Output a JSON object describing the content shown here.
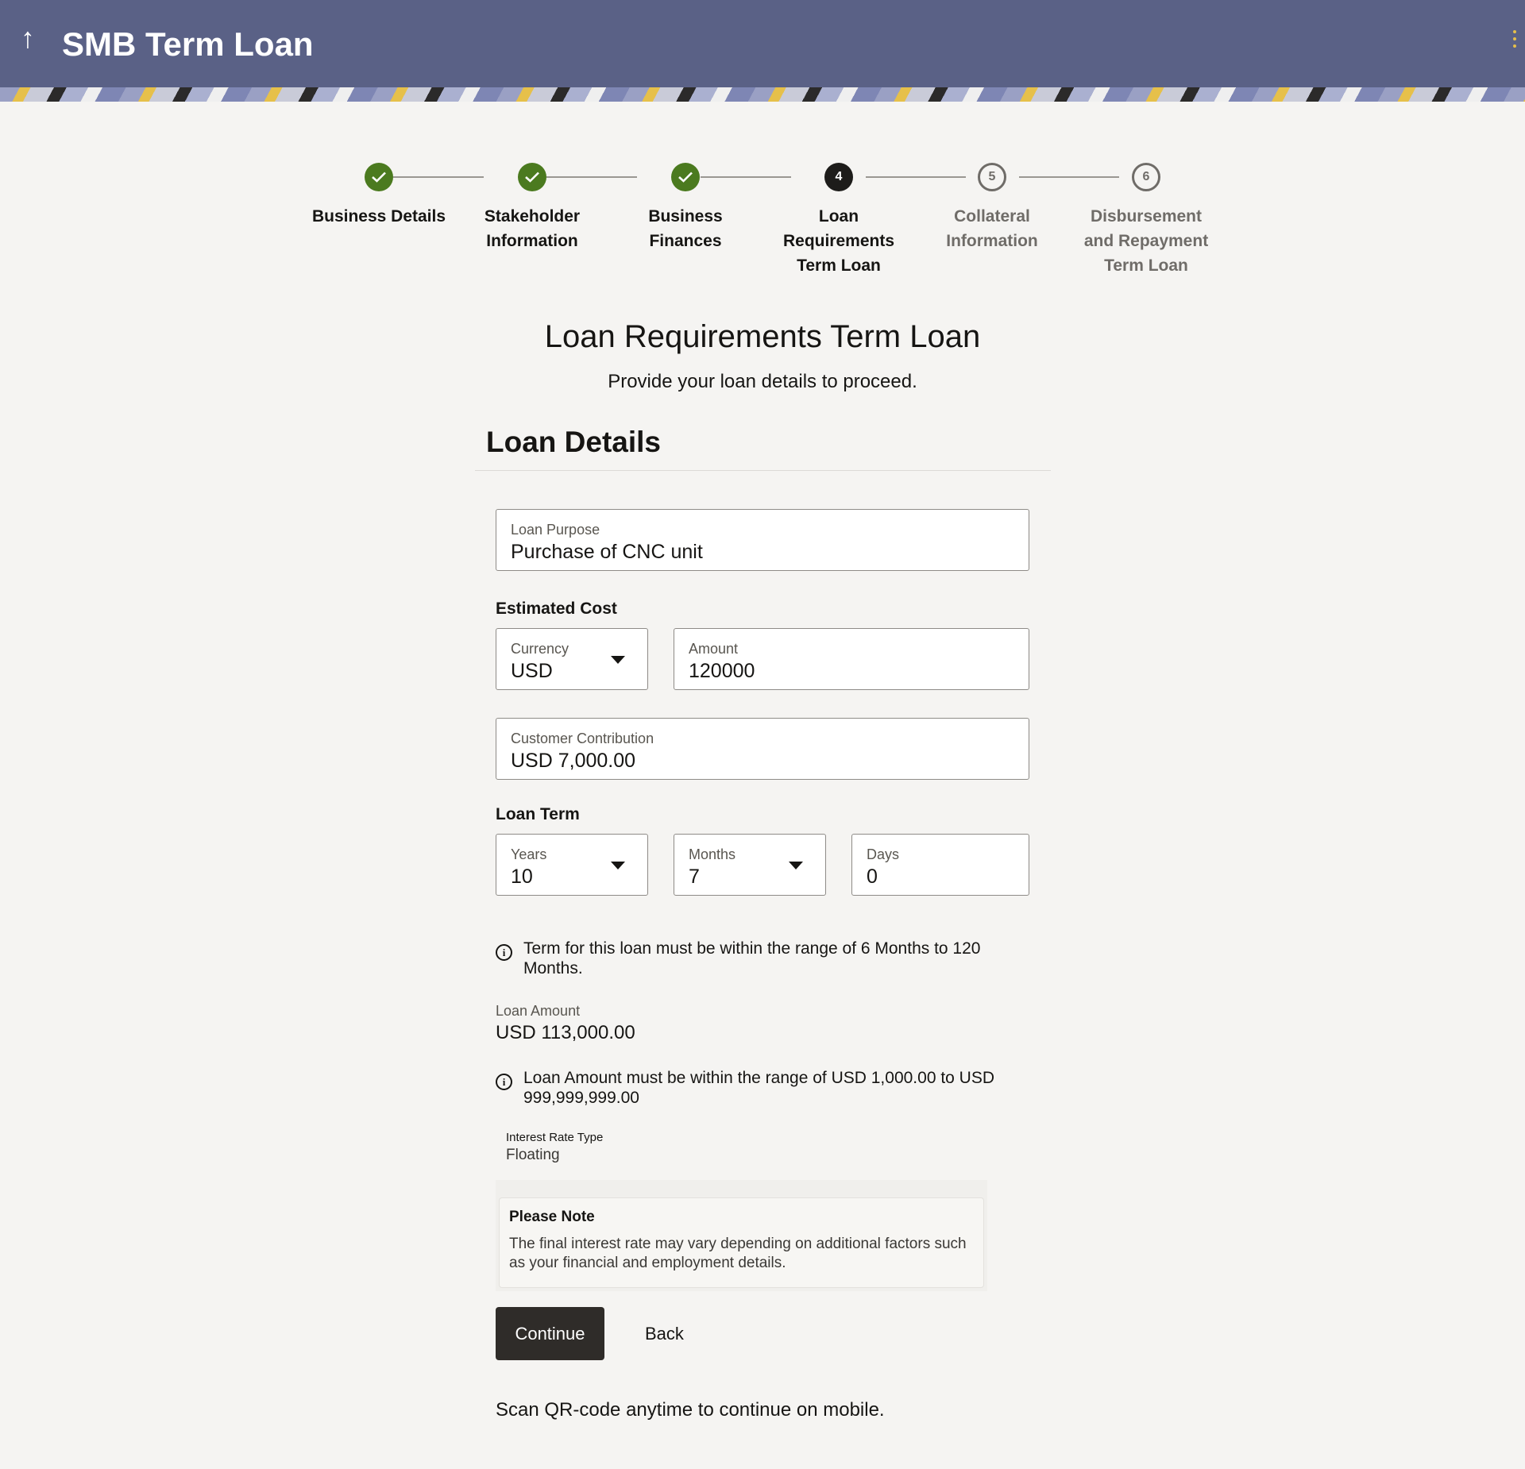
{
  "header": {
    "back_icon": "arrow-up-icon",
    "title": "SMB Term Loan",
    "menu_icon": "kebab-menu-icon",
    "accent_color": "#5a6186"
  },
  "stepper": {
    "steps": [
      {
        "number": "",
        "label_lines": [
          "Business Details"
        ],
        "status": "done"
      },
      {
        "number": "",
        "label_lines": [
          "Stakeholder",
          "Information"
        ],
        "status": "done"
      },
      {
        "number": "",
        "label_lines": [
          "Business",
          "Finances"
        ],
        "status": "done"
      },
      {
        "number": "4",
        "label_lines": [
          "Loan",
          "Requirements",
          "Term Loan"
        ],
        "status": "current"
      },
      {
        "number": "5",
        "label_lines": [
          "Collateral",
          "Information"
        ],
        "status": "pending"
      },
      {
        "number": "6",
        "label_lines": [
          "Disbursement",
          "and Repayment",
          "Term Loan"
        ],
        "status": "pending"
      }
    ],
    "done_color": "#4b7a1f"
  },
  "page": {
    "title": "Loan Requirements Term Loan",
    "subtitle": "Provide your loan details to proceed."
  },
  "loan_details": {
    "section_title": "Loan Details",
    "loan_purpose": {
      "label": "Loan Purpose",
      "value": "Purchase of CNC unit"
    },
    "estimated_cost": {
      "label": "Estimated Cost",
      "currency": {
        "label": "Currency",
        "value": "USD"
      },
      "amount": {
        "label": "Amount",
        "value": "120000"
      }
    },
    "customer_contribution": {
      "label": "Customer Contribution",
      "value": "USD 7,000.00"
    },
    "loan_term": {
      "label": "Loan Term",
      "years": {
        "label": "Years",
        "value": "10"
      },
      "months": {
        "label": "Months",
        "value": "7"
      },
      "days": {
        "label": "Days",
        "value": "0"
      }
    },
    "term_info": "Term for this loan must be within the range of 6 Months to 120 Months.",
    "loan_amount": {
      "label": "Loan Amount",
      "value": "USD 113,000.00"
    },
    "amount_info": "Loan Amount must be within the range of USD 1,000.00 to USD 999,999,999.00",
    "interest_rate_type": {
      "label": "Interest Rate Type",
      "value": "Floating"
    },
    "note": {
      "title": "Please Note",
      "text": "The final interest rate may vary depending on additional factors such as your financial and employment details."
    }
  },
  "actions": {
    "continue_label": "Continue",
    "back_label": "Back"
  },
  "footer": {
    "qr_text": "Scan QR-code anytime to continue on mobile."
  }
}
